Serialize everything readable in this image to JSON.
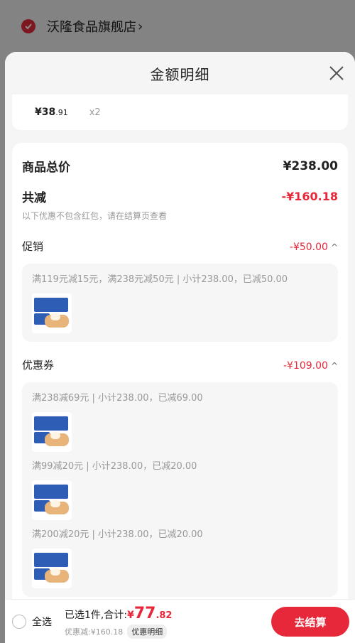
{
  "store": {
    "name": "沃隆食品旗舰店",
    "chevron": "›"
  },
  "sheet": {
    "title": "金额明细"
  },
  "item": {
    "price_main": "¥38",
    "price_decimal": ".91",
    "quantity": "x2"
  },
  "summary": {
    "total_label": "商品总价",
    "total_value": "¥238.00",
    "reduce_label": "共减",
    "reduce_value": "-¥160.18",
    "note": "以下优惠不包含红包，请在结算页查看"
  },
  "promotion": {
    "label": "促销",
    "value": "-¥50.00",
    "caret": "^",
    "items": [
      {
        "text": "满119元减15元，满238元减50元 | 小计238.00，已减50.00"
      }
    ]
  },
  "coupon": {
    "label": "优惠券",
    "value": "-¥109.00",
    "caret": "^",
    "items": [
      {
        "text": "满238减69元 | 小计238.00，已减69.00"
      },
      {
        "text": "满99减20元 | 小计238.00，已减20.00"
      },
      {
        "text": "满200减20元 | 小计238.00，已减20.00"
      }
    ]
  },
  "bottom_bar": {
    "select_all": "全选",
    "selected_text": "已选1件,合计:",
    "total_symbol": "¥",
    "total_int": "77",
    "total_dec": ".82",
    "discount_text": "优惠减:¥160.18",
    "detail_button": "优惠明细",
    "checkout_button": "去结算"
  },
  "colors": {
    "accent": "#e6283a",
    "bg": "#f5f5f5"
  },
  "icons": {
    "close": "close-icon",
    "check": "check-circle-icon",
    "product": "product-thumbnail"
  }
}
